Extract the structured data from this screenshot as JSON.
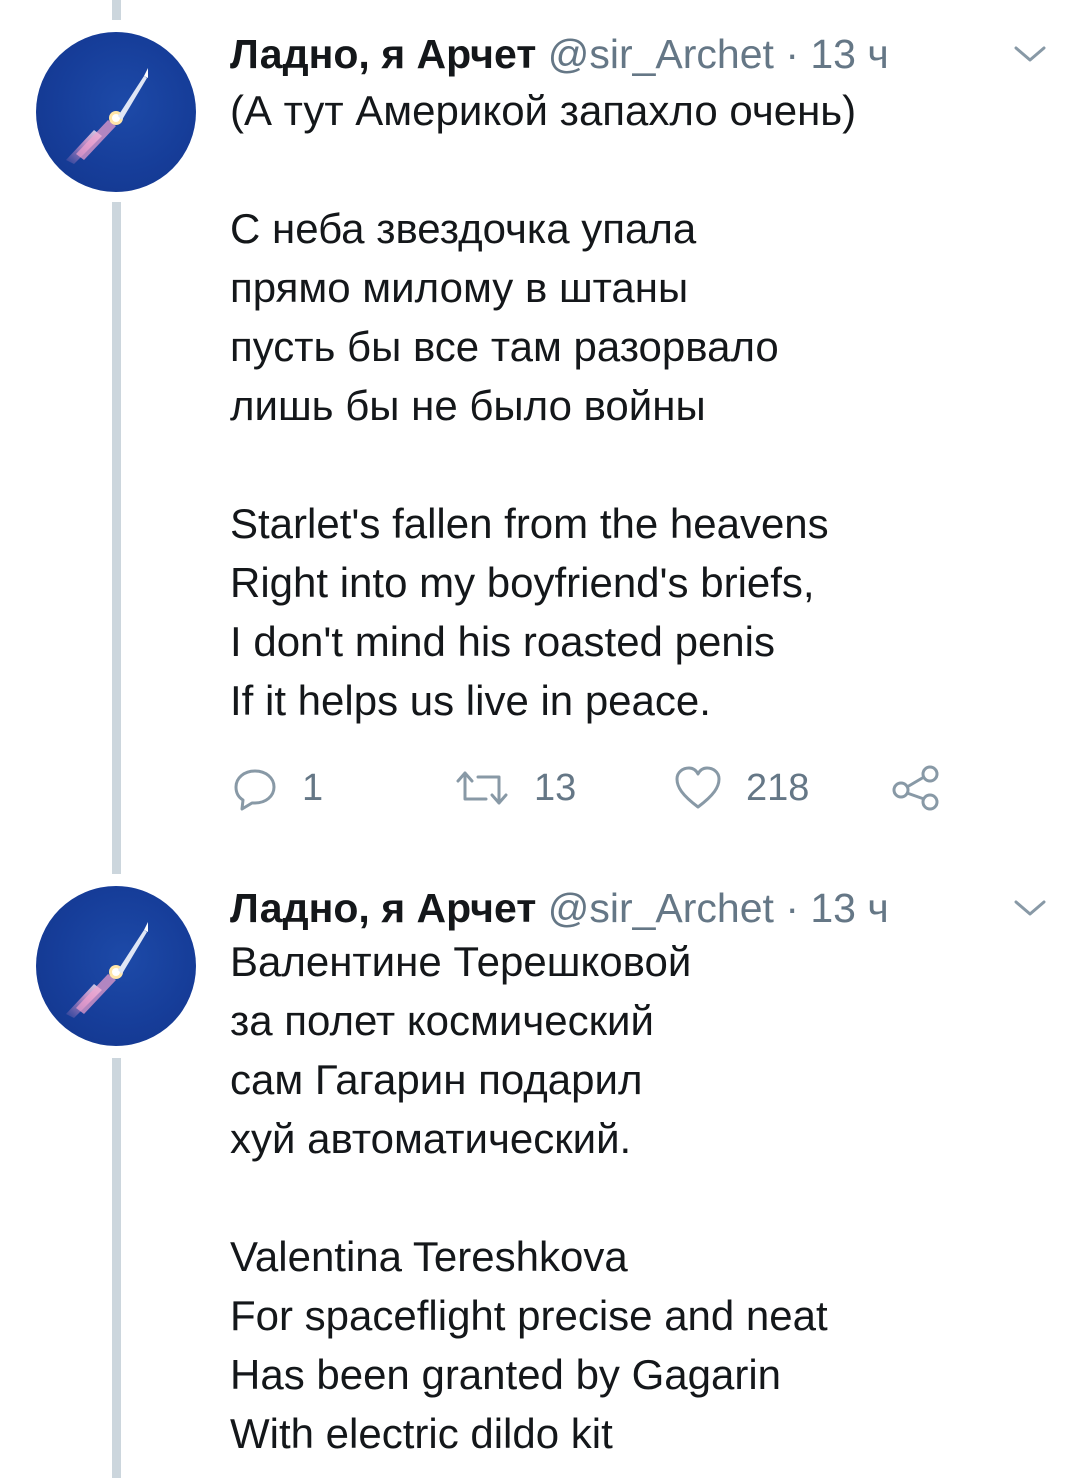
{
  "tweets": [
    {
      "author": "Ладно, я Арчет",
      "handle": "@sir_Archet",
      "separator": "·",
      "time": "13 ч",
      "lines": [
        "(А тут Америкой запахло очень)",
        "",
        "С неба звездочка упала",
        "прямо милому в штаны",
        "пусть бы все там разорвало",
        "лишь бы не было войны",
        "",
        "Starlet's fallen from the heavens",
        "Right into my boyfriend's briefs,",
        "I don't mind his roasted penis",
        "If it helps us live in peace."
      ],
      "actions": {
        "reply_count": "1",
        "retweet_count": "13",
        "like_count": "218"
      }
    },
    {
      "author": "Ладно, я Арчет",
      "handle": "@sir_Archet",
      "separator": "·",
      "time": "13 ч",
      "lines": [
        "Валентине Терешковой",
        "за полет космический",
        "сам Гагарин подарил",
        "хуй автоматический.",
        "",
        "Valentina Tereshkova",
        "For spaceflight precise and neat",
        "Has been granted by Gagarin",
        "With electric dildo kit"
      ]
    }
  ],
  "icons": {
    "avatar": "rocket-launch-avatar-icon",
    "menu": "chevron-down-icon",
    "reply": "reply-icon",
    "retweet": "retweet-icon",
    "like": "heart-icon",
    "share": "share-icon"
  },
  "colors": {
    "text": "#14171a",
    "secondary": "#657786",
    "thread_line": "#ccd6dd",
    "avatar_bg": "#163d99"
  }
}
